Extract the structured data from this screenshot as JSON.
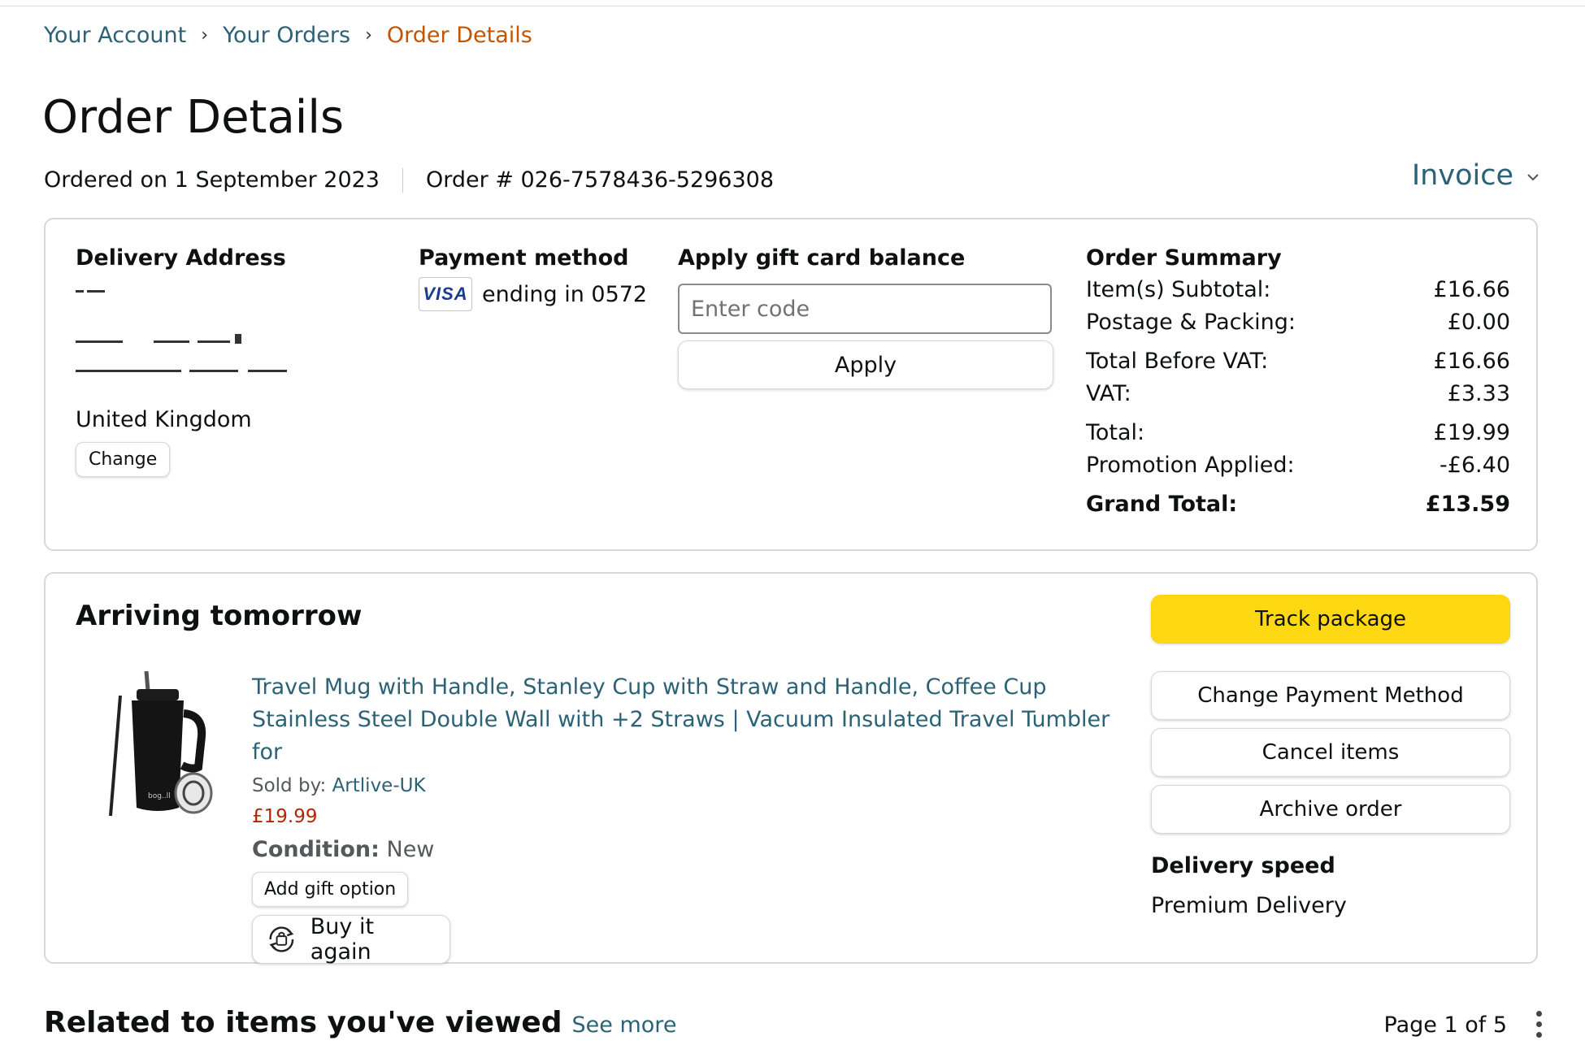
{
  "breadcrumb": {
    "items": [
      "Your Account",
      "Your Orders"
    ],
    "current": "Order Details",
    "separator": "›"
  },
  "page": {
    "title": "Order Details",
    "ordered_on": "Ordered on 1 September 2023",
    "order_number": "Order # 026-7578436-5296308",
    "invoice_label": "Invoice"
  },
  "delivery": {
    "title": "Delivery Address",
    "country": "United Kingdom",
    "change_label": "Change"
  },
  "payment": {
    "title": "Payment method",
    "card_brand": "VISA",
    "card_text": "ending in 0572"
  },
  "gift_card": {
    "title": "Apply gift card balance",
    "placeholder": "Enter code",
    "value": "",
    "apply_label": "Apply"
  },
  "order_summary": {
    "title": "Order Summary",
    "rows": [
      {
        "label": "Item(s) Subtotal:",
        "value": "£16.66"
      },
      {
        "label": "Postage & Packing:",
        "value": "£0.00"
      },
      {
        "label": "Total Before VAT:",
        "value": "£16.66"
      },
      {
        "label": "VAT:",
        "value": "£3.33"
      },
      {
        "label": "Total:",
        "value": "£19.99"
      },
      {
        "label": "Promotion Applied:",
        "value": "-£6.40"
      }
    ],
    "grand_total": {
      "label": "Grand Total:",
      "value": "£13.59"
    }
  },
  "shipment": {
    "title": "Arriving tomorrow",
    "product": {
      "title": "Travel Mug with Handle, Stanley Cup with Straw and Handle, Coffee Cup Stainless Steel Double Wall with +2 Straws | Vacuum Insulated Travel Tumbler for",
      "sold_by_label": "Sold by:",
      "seller": "Artlive-UK",
      "price": "£19.99",
      "condition_label": "Condition:",
      "condition": "New",
      "gift_option_label": "Add gift option",
      "buy_again_label": "Buy it again",
      "image_icon": "travel-mug-image"
    },
    "actions": {
      "track": "Track package",
      "change_payment": "Change Payment Method",
      "cancel": "Cancel items",
      "archive": "Archive order"
    },
    "delivery_speed_title": "Delivery speed",
    "delivery_speed": "Premium Delivery"
  },
  "related": {
    "title": "Related to items you've viewed",
    "see_more": "See more",
    "pager": "Page 1 of 5"
  },
  "colors": {
    "link": "#2b6275",
    "breadcrumb_current": "#c45500",
    "price": "#b12704",
    "track_button": "#ffd814",
    "border": "#d5d9d9"
  }
}
